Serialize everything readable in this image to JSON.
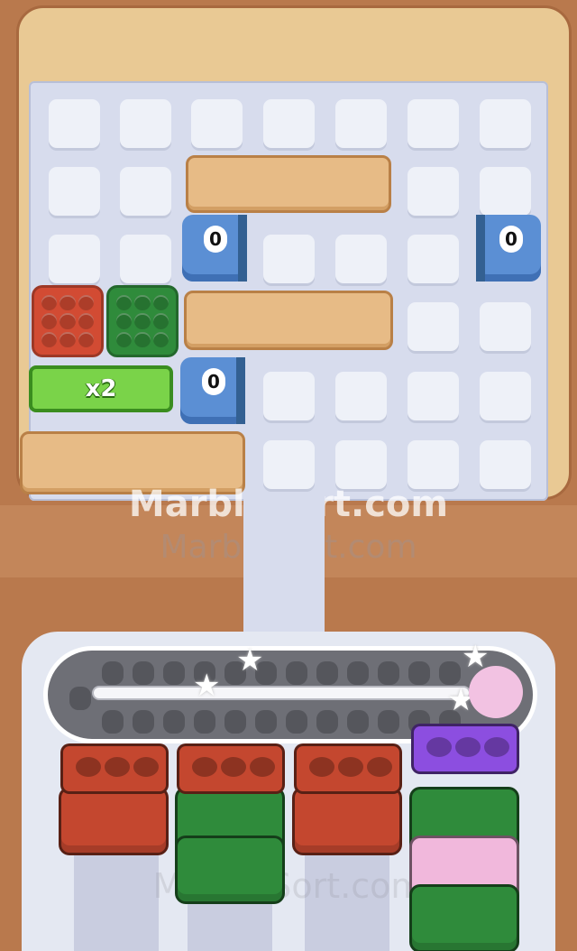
{
  "watermarks": {
    "primary": "Marblesort.com",
    "secondary": "MarbleSort.com",
    "lower": "MarbleSort.com"
  },
  "pipes": [
    {
      "id": "pipe-top",
      "count": "0"
    },
    {
      "id": "pipe-right",
      "count": "0"
    },
    {
      "id": "pipe-bottom",
      "count": "0"
    }
  ],
  "crates": [
    {
      "color": "#d24b33",
      "name": "red"
    },
    {
      "color": "#2f8b3b",
      "name": "green"
    }
  ],
  "bonus": {
    "label": "x2"
  },
  "columns": [
    {
      "lid_color": "#c4472f",
      "blocks": [
        "#c4472f"
      ]
    },
    {
      "lid_color": "#c4472f",
      "blocks": [
        "#2f8b3b",
        "#2f8b3b"
      ]
    },
    {
      "lid_color": "#c4472f",
      "blocks": [
        "#c4472f"
      ]
    },
    {
      "lid_color": "#8c4ee0",
      "blocks": [
        "#2f8b3b",
        "#f1b8dc",
        "#2f8b3b"
      ]
    }
  ],
  "colors": {
    "red": "#d24b33",
    "green": "#2f8b3b",
    "purple": "#8c4ee0",
    "pink": "#f1b8dc",
    "blue": "#5b8fd4",
    "wood": "#e7bb86"
  }
}
